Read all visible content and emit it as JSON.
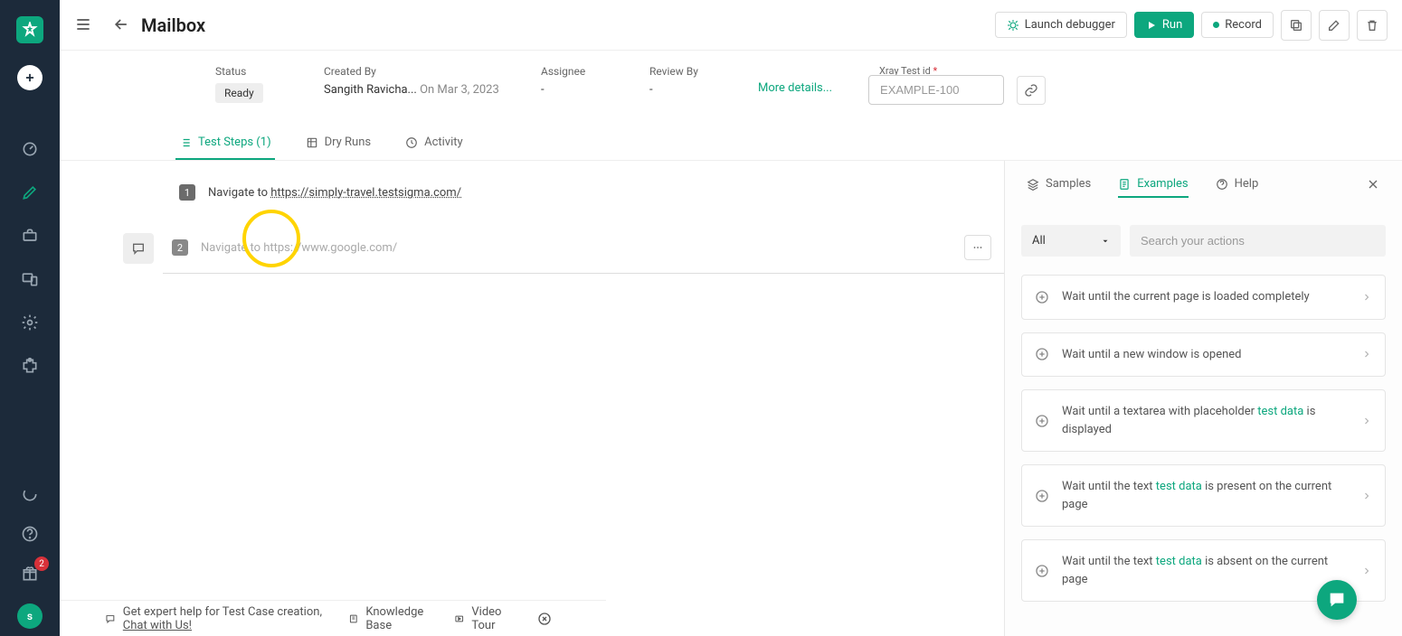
{
  "header": {
    "title": "Mailbox",
    "launch_debugger": "Launch debugger",
    "run": "Run",
    "record": "Record"
  },
  "meta": {
    "status_label": "Status",
    "status_value": "Ready",
    "created_by_label": "Created By",
    "created_by_value": "Sangith Ravicha...",
    "created_on": "On Mar 3, 2023",
    "assignee_label": "Assignee",
    "assignee_value": "-",
    "review_by_label": "Review By",
    "review_by_value": "-",
    "more_details": "More details...",
    "xray_label": "Xray Test id",
    "xray_placeholder": "EXAMPLE-100"
  },
  "tabs": {
    "test_steps": "Test Steps (1)",
    "dry_runs": "Dry Runs",
    "activity": "Activity"
  },
  "steps": {
    "step1_num": "1",
    "step1_prefix": "Navigate to ",
    "step1_url": "https://simply-travel.testsigma.com/",
    "step2_num": "2",
    "step2_placeholder": "Navigate to https://www.google.com/"
  },
  "panel": {
    "samples": "Samples",
    "examples": "Examples",
    "help": "Help",
    "filter_all": "All",
    "search_placeholder": "Search your actions",
    "actions": [
      {
        "pre": "Wait until the current page is loaded completely",
        "td": "",
        "post": ""
      },
      {
        "pre": "Wait until a new window is opened",
        "td": "",
        "post": ""
      },
      {
        "pre": "Wait until a textarea with placeholder ",
        "td": "test data",
        "post": " is displayed"
      },
      {
        "pre": "Wait until the text ",
        "td": "test data",
        "post": " is present on the current page"
      },
      {
        "pre": "Wait until the text ",
        "td": "test data",
        "post": " is absent on the current page"
      }
    ]
  },
  "footer": {
    "help_prefix": "Get expert help for Test Case creation, ",
    "chat": "Chat with Us!",
    "kb": "Knowledge Base",
    "video": "Video Tour"
  },
  "sidebar": {
    "badge_count": "2",
    "avatar_letter": "s"
  }
}
